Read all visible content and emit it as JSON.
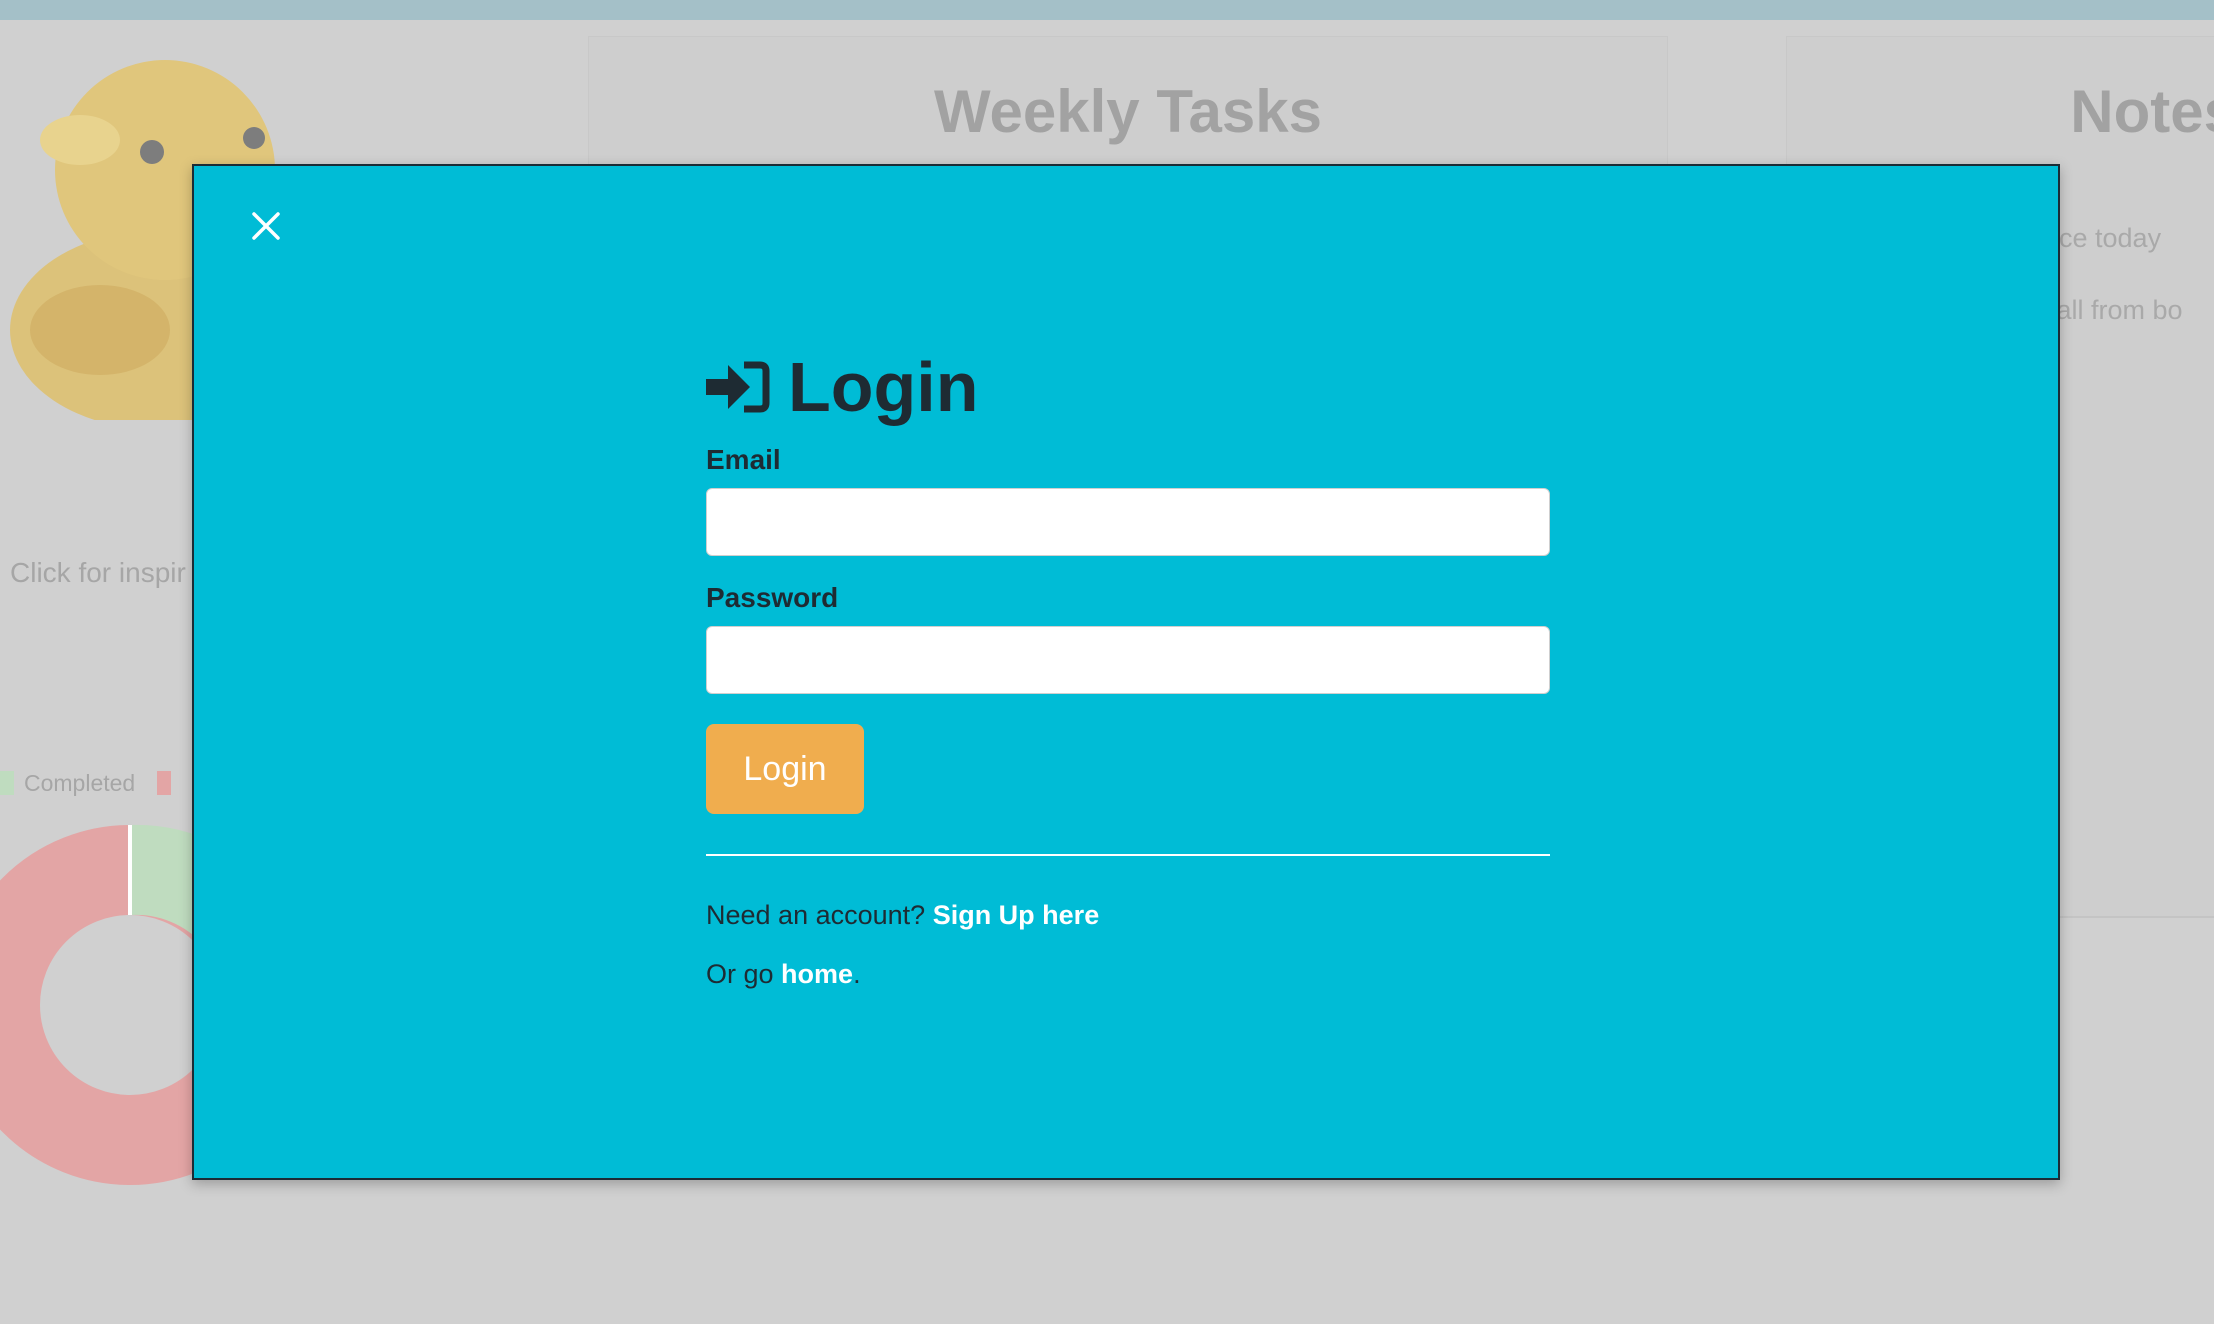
{
  "background": {
    "inspiration_text": "Click for inspir",
    "chart_legend": [
      {
        "label": "Completed",
        "color": "#bfdcbf"
      },
      {
        "label": "",
        "color": "#e3a5a5"
      }
    ],
    "weekly_tasks_title": "Weekly Tasks",
    "notes_title": "Notes",
    "notes": [
      "ice today",
      "call from bo"
    ]
  },
  "modal": {
    "close_icon": "close-icon",
    "title_icon": "sign-in-icon",
    "title": "Login",
    "email_label": "Email",
    "email_value": "",
    "password_label": "Password",
    "password_value": "",
    "login_button": "Login",
    "signup_prompt": "Need an account?",
    "signup_link": "Sign Up here",
    "home_prefix": "Or go",
    "home_link": "home",
    "home_suffix": "."
  },
  "colors": {
    "modal_bg": "#00bcd6",
    "button_bg": "#f0ad4e",
    "text_dark": "#1e2b33",
    "page_dim": "#d0d0d0"
  }
}
